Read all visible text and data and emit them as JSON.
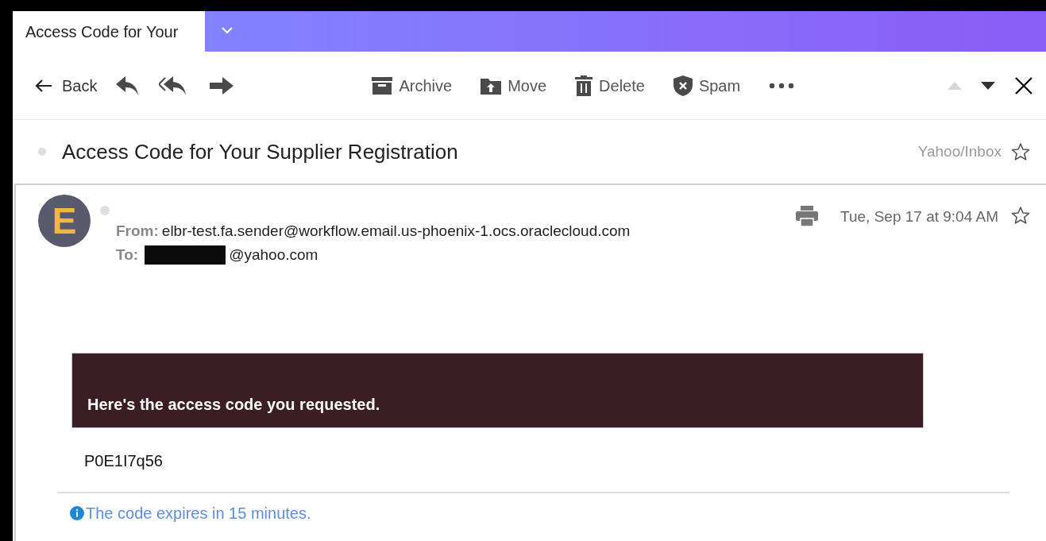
{
  "tab": {
    "title": "Access Code for Your"
  },
  "toolbar": {
    "back": "Back",
    "actions": [
      {
        "kind": "archive",
        "label": "Archive"
      },
      {
        "kind": "move",
        "label": "Move"
      },
      {
        "kind": "delete",
        "label": "Delete"
      },
      {
        "kind": "spam",
        "label": "Spam"
      }
    ],
    "nav": [
      {
        "kind": "up",
        "disabled": true
      },
      {
        "kind": "down",
        "disabled": false
      }
    ]
  },
  "subject": {
    "title": "Access Code for Your Supplier Registration",
    "folder": "Yahoo/Inbox"
  },
  "message": {
    "avatar": "E",
    "from_label": "From:",
    "from": "elbr-test.fa.sender@workflow.email.us-phoenix-1.ocs.oraclecloud.com",
    "to_label": "To:",
    "to": "@yahoo.com",
    "date": "Tue, Sep 17 at 9:04 AM",
    "banner": "Here's the access code you requested.",
    "code": "P0E1I7q56",
    "note": "The code expires in 15 minutes."
  }
}
